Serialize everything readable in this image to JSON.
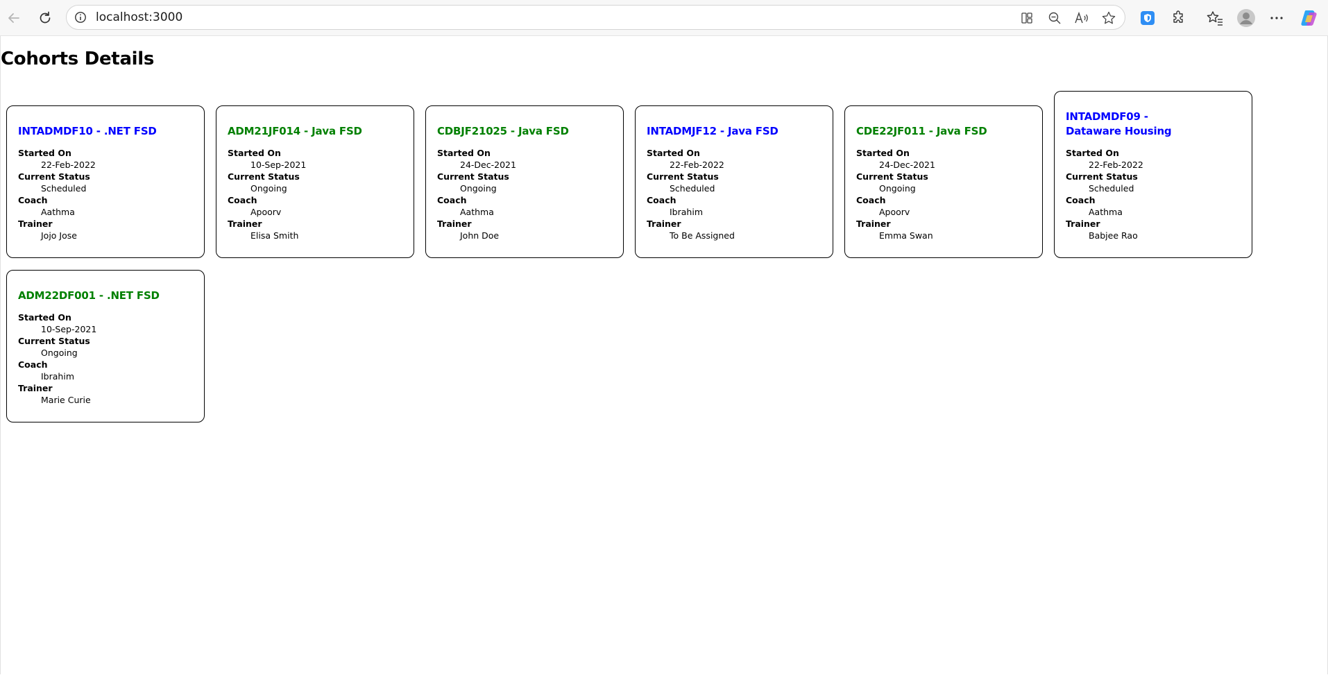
{
  "browser": {
    "url": "localhost:3000",
    "icons": [
      "back-arrow-icon",
      "reload-icon",
      "site-info-icon",
      "app-available-icon",
      "zoom-out-icon",
      "read-aloud-icon",
      "favorite-star-icon",
      "browser-essentials-icon",
      "extensions-icon",
      "favorites-icon",
      "profile-avatar-icon",
      "more-menu-icon",
      "copilot-icon"
    ]
  },
  "page": {
    "title": "Cohorts Details",
    "labels": {
      "started_on": "Started On",
      "current_status": "Current Status",
      "coach": "Coach",
      "trainer": "Trainer"
    }
  },
  "colors": {
    "scheduled": "#0000ff",
    "ongoing": "#008000"
  },
  "cohorts": [
    {
      "title": "INTADMDF10 - .NET FSD",
      "started_on": "22-Feb-2022",
      "status": "Scheduled",
      "coach": "Aathma",
      "trainer": "Jojo Jose"
    },
    {
      "title": "ADM21JF014 - Java FSD",
      "started_on": "10-Sep-2021",
      "status": "Ongoing",
      "coach": "Apoorv",
      "trainer": "Elisa Smith"
    },
    {
      "title": "CDBJF21025 - Java FSD",
      "started_on": "24-Dec-2021",
      "status": "Ongoing",
      "coach": "Aathma",
      "trainer": "John Doe"
    },
    {
      "title": "INTADMJF12 - Java FSD",
      "started_on": "22-Feb-2022",
      "status": "Scheduled",
      "coach": "Ibrahim",
      "trainer": "To Be Assigned"
    },
    {
      "title": "CDE22JF011 - Java FSD",
      "started_on": "24-Dec-2021",
      "status": "Ongoing",
      "coach": "Apoorv",
      "trainer": "Emma Swan"
    },
    {
      "title": "INTADMDF09 - Dataware Housing",
      "started_on": "22-Feb-2022",
      "status": "Scheduled",
      "coach": "Aathma",
      "trainer": "Babjee Rao"
    },
    {
      "title": "ADM22DF001 - .NET FSD",
      "started_on": "10-Sep-2021",
      "status": "Ongoing",
      "coach": "Ibrahim",
      "trainer": "Marie Curie"
    }
  ]
}
